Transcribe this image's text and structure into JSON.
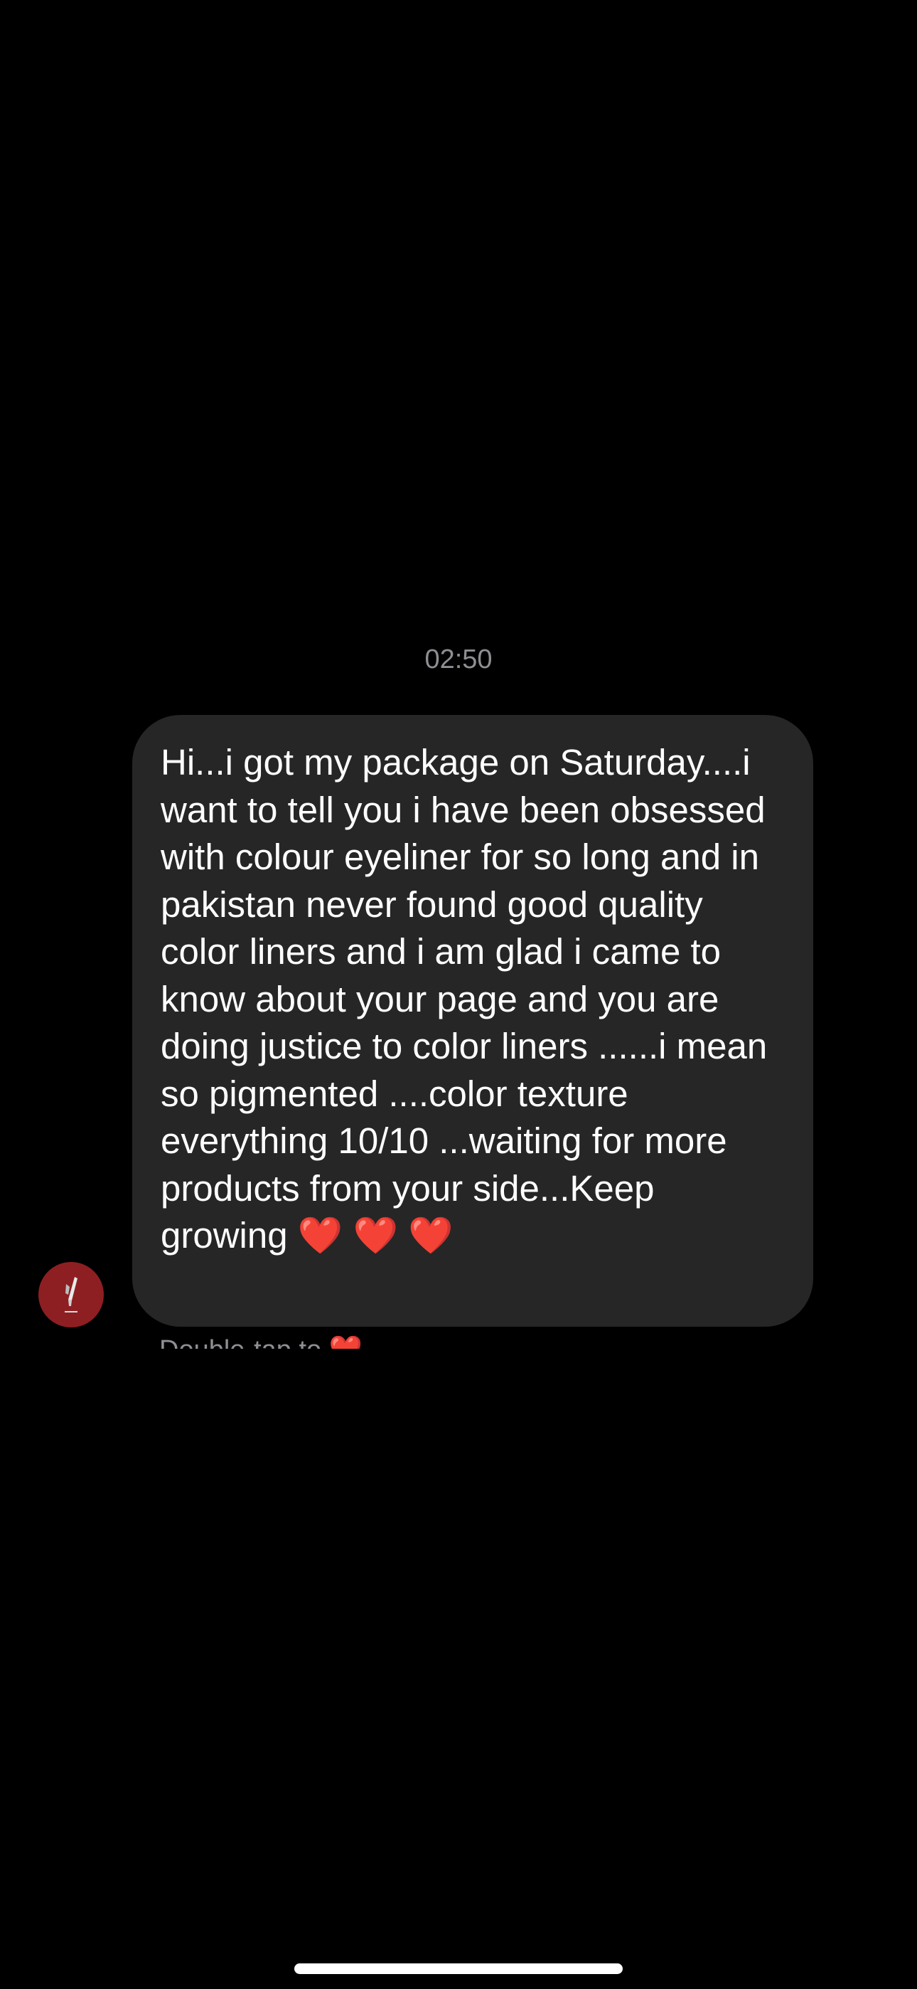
{
  "conversation": {
    "timestamp": "02:50",
    "message": {
      "text": "Hi...i got my package on Saturday....i want to tell you i have been obsessed with colour eyeliner for so long and in pakistan never found good quality color liners and i am glad i came to know about your page and you are doing justice to color liners ......i mean so pigmented ....color texture everything 10/10 ...waiting for more products from your side...Keep growing ❤️ ❤️ ❤️"
    },
    "hint": "Double-tap to ❤️"
  },
  "colors": {
    "background": "#000000",
    "bubble": "#262626",
    "avatar": "#8d1f22",
    "timestamp": "#8e8e93"
  },
  "icons": {
    "avatar": "brush-logo-icon"
  }
}
